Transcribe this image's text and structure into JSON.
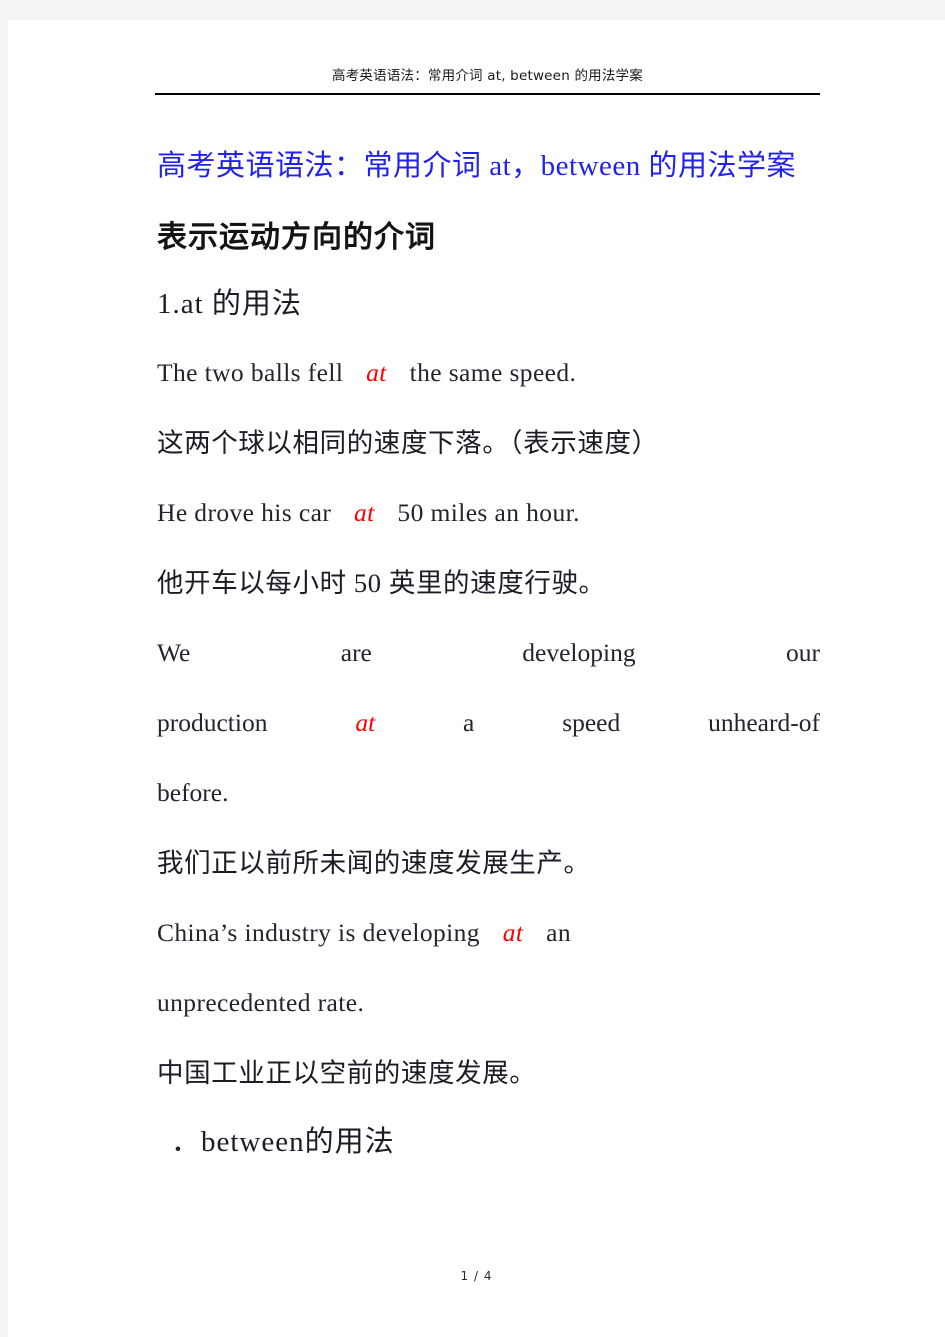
{
  "header": {
    "running_title": "高考英语语法：常用介词 at, between 的用法学案"
  },
  "document": {
    "title": "高考英语语法：常用介词 at，between 的用法学案",
    "heading_main": "表示运动方向的介词",
    "section_1_heading": "1.at 的用法",
    "section_2_heading": "．between的用法",
    "keyword": "at",
    "examples": [
      {
        "english_before": "The two balls fell",
        "keyword": "at",
        "english_after": "the same speed.",
        "chinese": "这两个球以相同的速度下落。（表示速度）"
      },
      {
        "english_before": "He drove his car",
        "keyword": "at",
        "english_after": "50 miles an hour.",
        "chinese": "他开车以每小时 50 英里的速度行驶。"
      },
      {
        "justified_line_1": [
          "We",
          "are",
          "developing",
          "our"
        ],
        "justified_line_2_a": "production",
        "justified_line_2_keyword": "at",
        "justified_line_2_rest": [
          "a",
          "speed",
          "unheard-of"
        ],
        "justified_line_3": "before.",
        "chinese": "我们正以前所未闻的速度发展生产。"
      },
      {
        "english_before": "China’s industry is developing",
        "keyword": "at",
        "english_after": "an",
        "english_line_2": "unprecedented rate.",
        "chinese": "中国工业正以空前的速度发展。"
      }
    ]
  },
  "footer": {
    "page_indicator": "1 / 4"
  },
  "colors": {
    "title_blue": "#2222ee",
    "keyword_red": "#ff0000",
    "page_background": "#ffffff",
    "canvas_background": "#f4f4f4"
  }
}
